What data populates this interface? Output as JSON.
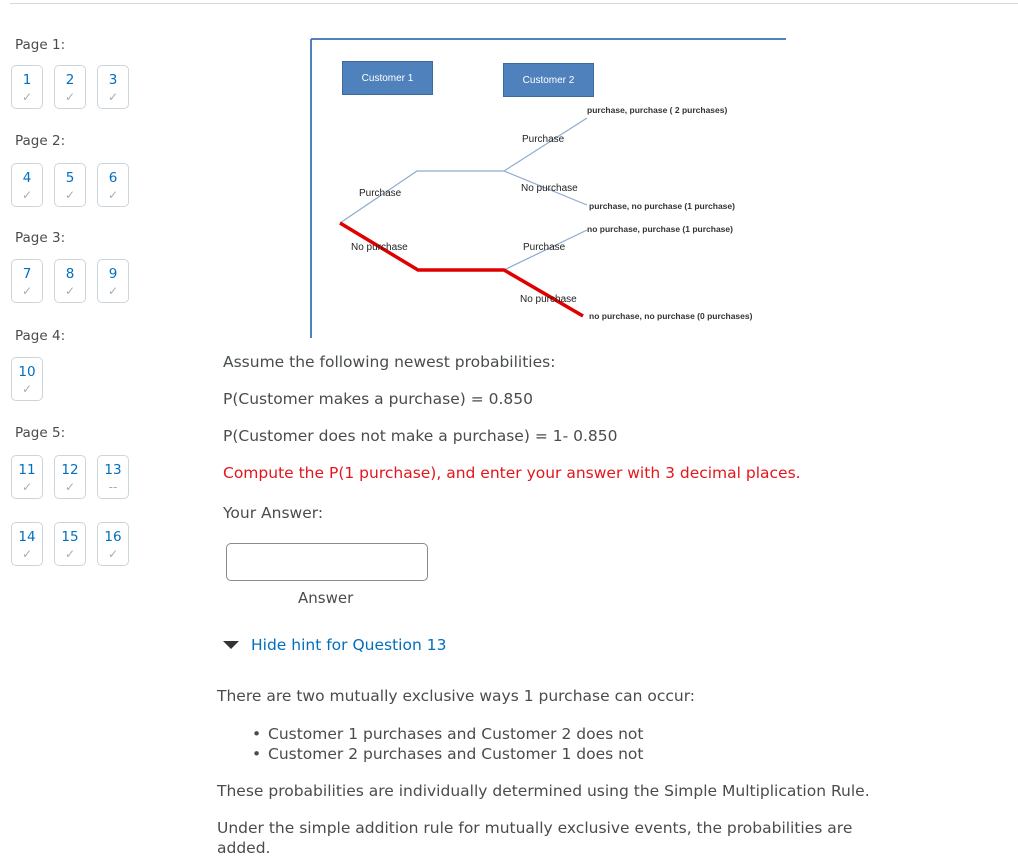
{
  "sidebar": {
    "pages": [
      {
        "label": "Page 1:",
        "questions": [
          {
            "num": "1",
            "status": "✓"
          },
          {
            "num": "2",
            "status": "✓"
          },
          {
            "num": "3",
            "status": "✓"
          }
        ]
      },
      {
        "label": "Page 2:",
        "questions": [
          {
            "num": "4",
            "status": "✓"
          },
          {
            "num": "5",
            "status": "✓"
          },
          {
            "num": "6",
            "status": "✓"
          }
        ]
      },
      {
        "label": "Page 3:",
        "questions": [
          {
            "num": "7",
            "status": "✓"
          },
          {
            "num": "8",
            "status": "✓"
          },
          {
            "num": "9",
            "status": "✓"
          }
        ]
      },
      {
        "label": "Page 4:",
        "questions": [
          {
            "num": "10",
            "status": "✓"
          }
        ]
      },
      {
        "label": "Page 5:",
        "questions": [
          {
            "num": "11",
            "status": "✓"
          },
          {
            "num": "12",
            "status": "✓"
          },
          {
            "num": "13",
            "status": "--"
          },
          {
            "num": "14",
            "status": "✓"
          },
          {
            "num": "15",
            "status": "✓"
          },
          {
            "num": "16",
            "status": "✓"
          }
        ]
      }
    ]
  },
  "diagram": {
    "customer1": "Customer 1",
    "customer2": "Customer 2",
    "branches": {
      "c1_purchase": "Purchase",
      "c1_no_purchase": "No purchase",
      "c2_upper_purchase": "Purchase",
      "c2_upper_no_purchase": "No purchase",
      "c2_lower_purchase": "Purchase",
      "c2_lower_no_purchase": "No purchase"
    },
    "outcomes": {
      "pp": "purchase, purchase  ( 2 purchases)",
      "pn": "purchase, no purchase (1 purchase)",
      "np": "no purchase, purchase (1 purchase)",
      "nn": "no purchase, no purchase (0 purchases)"
    },
    "colors": {
      "tree_line": "#8eaad0",
      "highlight_path": "#e00000",
      "box": "#4f81bd"
    }
  },
  "question": {
    "intro": "Assume the following newest probabilities:",
    "p_purchase": "P(Customer makes a purchase) = 0.850",
    "p_no_purchase": "P(Customer does not make a purchase) = 1- 0.850",
    "instruction": "Compute the P(1 purchase), and enter your answer with 3 decimal places.",
    "your_answer_label": "Your Answer:",
    "answer_value": "",
    "answer_label": "Answer"
  },
  "hint": {
    "toggle_label": "Hide hint for Question 13",
    "intro": "There are two mutually exclusive ways 1 purchase can occur:",
    "bullets": [
      "Customer 1 purchases and Customer 2 does not",
      "Customer 2 purchases and Customer 1 does not"
    ],
    "para1": "These probabilities are individually determined using the Simple Multiplication Rule.",
    "para2": "Under the simple addition rule for mutually exclusive events, the probabilities are",
    "para2_cont": "added."
  },
  "colors": {
    "link": "#006fbf",
    "instruction_red": "#e3161b",
    "text": "#494c4e"
  }
}
